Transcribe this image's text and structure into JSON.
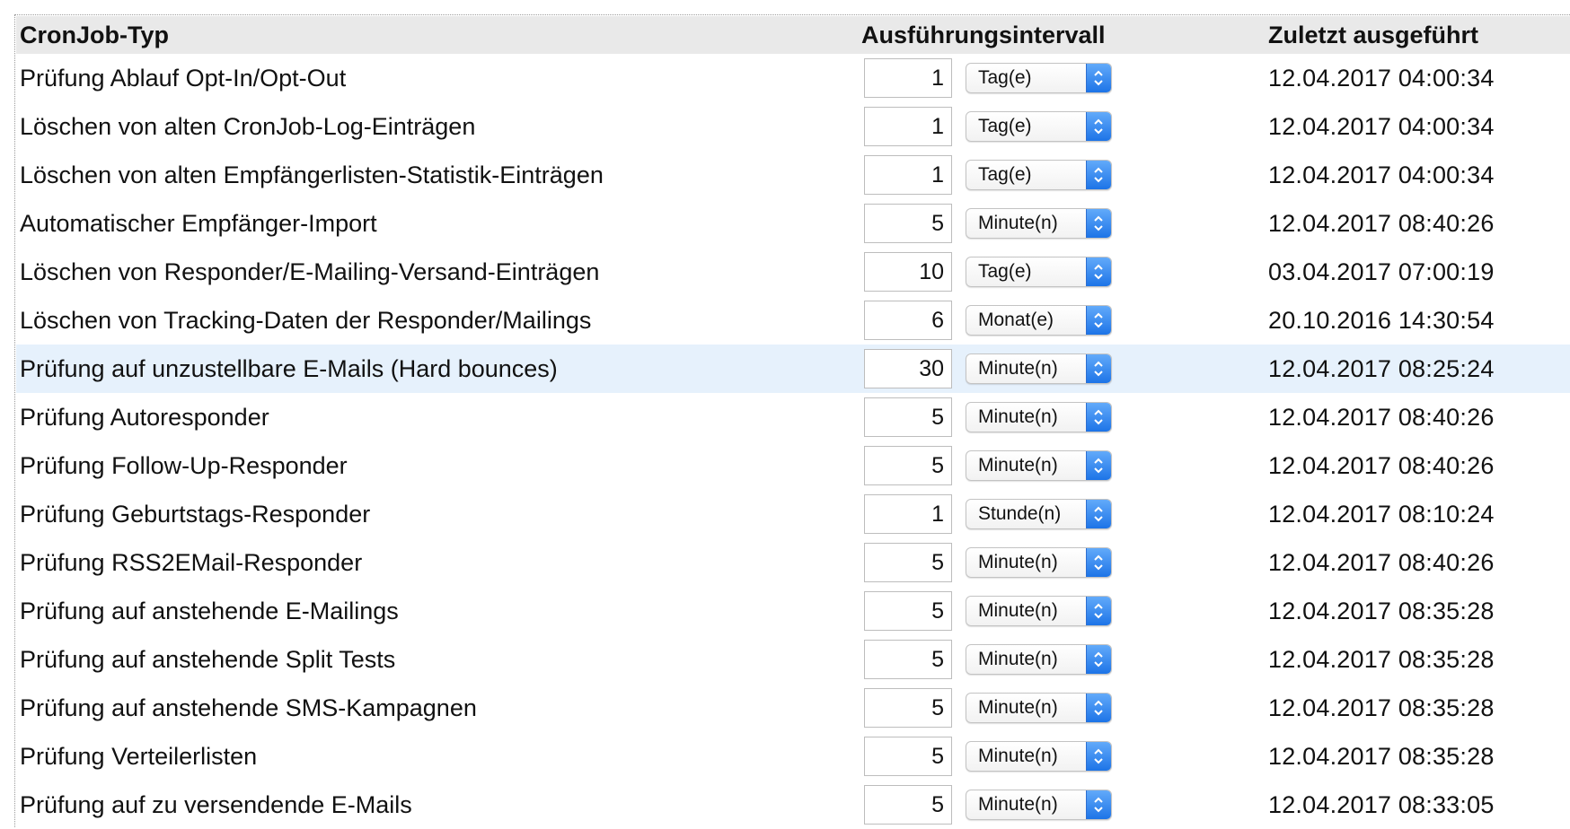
{
  "table": {
    "headers": {
      "type": "CronJob-Typ",
      "interval": "Ausführungsintervall",
      "last_run": "Zuletzt ausgeführt"
    },
    "rows": [
      {
        "name": "Prüfung Ablauf Opt-In/Opt-Out",
        "interval_value": "1",
        "unit": "Tag(e)",
        "last_run": "12.04.2017 04:00:34"
      },
      {
        "name": "Löschen von alten CronJob-Log-Einträgen",
        "interval_value": "1",
        "unit": "Tag(e)",
        "last_run": "12.04.2017 04:00:34"
      },
      {
        "name": "Löschen von alten Empfängerlisten-Statistik-Einträgen",
        "interval_value": "1",
        "unit": "Tag(e)",
        "last_run": "12.04.2017 04:00:34"
      },
      {
        "name": "Automatischer Empfänger-Import",
        "interval_value": "5",
        "unit": "Minute(n)",
        "last_run": "12.04.2017 08:40:26"
      },
      {
        "name": "Löschen von Responder/E-Mailing-Versand-Einträgen",
        "interval_value": "10",
        "unit": "Tag(e)",
        "last_run": "03.04.2017 07:00:19"
      },
      {
        "name": "Löschen von Tracking-Daten der Responder/Mailings",
        "interval_value": "6",
        "unit": "Monat(e)",
        "last_run": "20.10.2016 14:30:54"
      },
      {
        "name": "Prüfung auf unzustellbare E-Mails (Hard bounces)",
        "interval_value": "30",
        "unit": "Minute(n)",
        "last_run": "12.04.2017 08:25:24",
        "highlighted": true
      },
      {
        "name": "Prüfung Autoresponder",
        "interval_value": "5",
        "unit": "Minute(n)",
        "last_run": "12.04.2017 08:40:26"
      },
      {
        "name": "Prüfung Follow-Up-Responder",
        "interval_value": "5",
        "unit": "Minute(n)",
        "last_run": "12.04.2017 08:40:26"
      },
      {
        "name": "Prüfung Geburtstags-Responder",
        "interval_value": "1",
        "unit": "Stunde(n)",
        "last_run": "12.04.2017 08:10:24"
      },
      {
        "name": "Prüfung RSS2EMail-Responder",
        "interval_value": "5",
        "unit": "Minute(n)",
        "last_run": "12.04.2017 08:40:26"
      },
      {
        "name": "Prüfung auf anstehende E-Mailings",
        "interval_value": "5",
        "unit": "Minute(n)",
        "last_run": "12.04.2017 08:35:28"
      },
      {
        "name": "Prüfung auf anstehende Split Tests",
        "interval_value": "5",
        "unit": "Minute(n)",
        "last_run": "12.04.2017 08:35:28"
      },
      {
        "name": "Prüfung auf anstehende SMS-Kampagnen",
        "interval_value": "5",
        "unit": "Minute(n)",
        "last_run": "12.04.2017 08:35:28"
      },
      {
        "name": "Prüfung Verteilerlisten",
        "interval_value": "5",
        "unit": "Minute(n)",
        "last_run": "12.04.2017 08:35:28"
      },
      {
        "name": "Prüfung auf zu versendende E-Mails",
        "interval_value": "5",
        "unit": "Minute(n)",
        "last_run": "12.04.2017 08:33:05"
      }
    ]
  },
  "icons": {
    "select_arrows": "chevron-up-down-icon"
  },
  "colors": {
    "header_background": "#e9e9e9",
    "highlight_row": "#e6f1fc",
    "select_button": "#2f82ef"
  }
}
